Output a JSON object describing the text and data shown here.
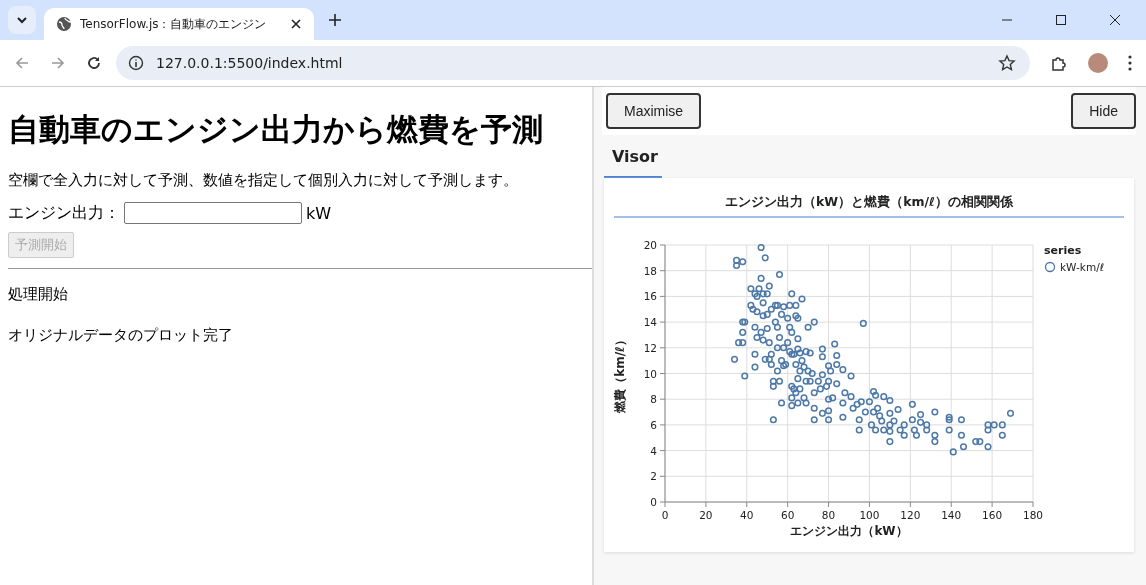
{
  "browser": {
    "tab_title": "TensorFlow.js：自動車のエンジン",
    "url": "127.0.0.1:5500/index.html"
  },
  "page": {
    "heading": "自動車のエンジン出力から燃費を予測",
    "description": "空欄で全入力に対して予測、数値を指定して個別入力に対して予測します。",
    "input_label": "エンジン出力：",
    "input_unit": "kW",
    "predict_button": {
      "label": "予測開始",
      "disabled": true
    },
    "log": [
      "処理開始",
      "オリジナルデータのプロット完了"
    ]
  },
  "visor": {
    "buttons": [
      "Maximise",
      "Hide"
    ],
    "tabs": [
      {
        "label": "Visor",
        "selected": true
      }
    ],
    "chart": {
      "legend_title": "series",
      "chart_data": {
        "type": "scatter",
        "grid": true,
        "title": "エンジン出力（kW）と燃費（km/ℓ）の相関関係",
        "xlabel": "エンジン出力（kW）",
        "ylabel": "燃費（km/ℓ）",
        "xlim": [
          0,
          180
        ],
        "ylim": [
          0,
          20
        ],
        "xticks": [
          0,
          20,
          40,
          60,
          80,
          100,
          120,
          140,
          160,
          180
        ],
        "yticks": [
          0,
          2,
          4,
          6,
          8,
          10,
          12,
          14,
          16,
          18,
          20
        ],
        "x": [
          34,
          35,
          35,
          38,
          36,
          38,
          38,
          38,
          39,
          39,
          42,
          42,
          43,
          44,
          44,
          44,
          44,
          45,
          45,
          45,
          46,
          47,
          47,
          47,
          48,
          48,
          48,
          48,
          49,
          49,
          50,
          50,
          50,
          51,
          51,
          51,
          52,
          52,
          52,
          53,
          53,
          53,
          54,
          54,
          55,
          55,
          55,
          55,
          56,
          56,
          56,
          57,
          57,
          57,
          58,
          58,
          58,
          59,
          60,
          60,
          61,
          61,
          61,
          62,
          62,
          62,
          62,
          62,
          62,
          63,
          63,
          64,
          64,
          64,
          64,
          65,
          65,
          65,
          65,
          65,
          66,
          66,
          66,
          67,
          67,
          68,
          68,
          69,
          69,
          69,
          70,
          70,
          71,
          71,
          72,
          73,
          73,
          73,
          73,
          75,
          76,
          77,
          77,
          77,
          77,
          79,
          80,
          80,
          80,
          80,
          80,
          81,
          82,
          83,
          84,
          84,
          84,
          87,
          87,
          87,
          88,
          91,
          91,
          92,
          94,
          95,
          95,
          96,
          97,
          98,
          100,
          101,
          102,
          102,
          103,
          103,
          104,
          105,
          106,
          107,
          107,
          110,
          110,
          110,
          110,
          110,
          112,
          114,
          115,
          117,
          117,
          121,
          121,
          122,
          123,
          125,
          125,
          128,
          128,
          132,
          132,
          132,
          139,
          139,
          139,
          141,
          145,
          145,
          146,
          152,
          154,
          158,
          158,
          158,
          161,
          165,
          165,
          169
        ],
        "series": [
          {
            "name": "kW-km/ℓ",
            "color": "#4c78a8",
            "values": [
              11.1,
              18.8,
              18.4,
              18.7,
              12.4,
              12.4,
              13.2,
              14,
              14,
              9.8,
              16.6,
              15.3,
              15,
              16.2,
              13.6,
              11.5,
              10.5,
              16,
              14.8,
              12.8,
              16.6,
              19.8,
              17.4,
              13.2,
              16.2,
              15.5,
              14.5,
              12.6,
              19,
              11.1,
              16.2,
              14.6,
              13.5,
              16.8,
              12.4,
              11.1,
              15,
              11.5,
              10.7,
              9.4,
              9,
              6.4,
              15.3,
              14,
              15.3,
              13.6,
              12,
              10.2,
              17.7,
              12.8,
              9.4,
              14.6,
              11,
              7.7,
              15.2,
              12,
              10.6,
              10.7,
              14.3,
              12.4,
              15.3,
              13.6,
              11.7,
              16.2,
              13.2,
              11.5,
              9,
              8.1,
              7.5,
              11.5,
              8.8,
              15.3,
              14.5,
              10.7,
              8.5,
              14.3,
              12.7,
              11.9,
              9.6,
              7.7,
              11.6,
              10.2,
              8.8,
              15.8,
              11,
              10.5,
              8.1,
              11.7,
              9.4,
              7.7,
              13.6,
              10.2,
              11.6,
              9.4,
              10,
              14,
              8.5,
              7.3,
              6.4,
              9.4,
              8.8,
              11.9,
              11.3,
              9.9,
              6.9,
              9,
              10.6,
              9.4,
              8,
              7.1,
              6.4,
              10.2,
              8.1,
              12.3,
              11.4,
              10.7,
              9.2,
              10.3,
              7.7,
              6.6,
              8.5,
              9.8,
              8.2,
              7.3,
              7.6,
              6.4,
              5.6,
              7.8,
              13.9,
              7,
              7.8,
              6,
              8.6,
              7,
              8.3,
              5.6,
              7.3,
              6.7,
              6.3,
              8.2,
              5.6,
              7.9,
              6.9,
              6,
              5.5,
              4.7,
              6.3,
              7.2,
              5.6,
              6,
              5.2,
              7.6,
              6.4,
              5.6,
              5.2,
              6.8,
              6.2,
              6,
              5.6,
              7,
              5.2,
              4.7,
              6.6,
              6.4,
              5.6,
              3.9,
              6.4,
              5.2,
              4.3,
              4.7,
              4.7,
              6,
              5.6,
              4.3,
              6,
              6,
              5.2,
              6.9
            ]
          }
        ]
      }
    }
  }
}
